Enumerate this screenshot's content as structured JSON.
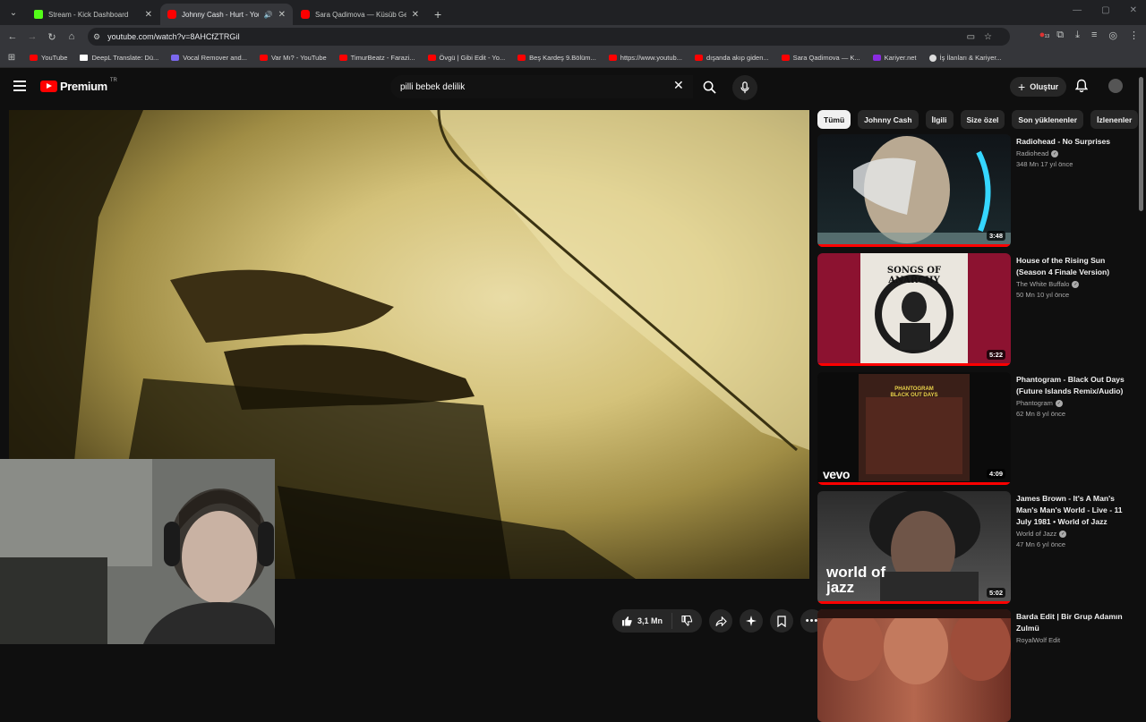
{
  "browser": {
    "tabs": [
      {
        "title": "Stream - Kick Dashboard",
        "color": "#53fc18"
      },
      {
        "title": "Johnny Cash - Hurt - YouTube",
        "color": "#ff0000"
      },
      {
        "title": "Sara Qadimova — Küsüb Getdi",
        "color": "#ff0000"
      }
    ],
    "url": "youtube.com/watch?v=8AHCfZTRGiI",
    "bookmarks": [
      {
        "label": "YouTube",
        "color": "#ff0000"
      },
      {
        "label": "DeepL Translate: Dü...",
        "color": "#ffffff"
      },
      {
        "label": "Vocal Remover and...",
        "color": "#7b68ee"
      },
      {
        "label": "Var Mı? - YouTube",
        "color": "#ff0000"
      },
      {
        "label": "TimurBeatz - Farazi...",
        "color": "#ff0000"
      },
      {
        "label": "Övgü | Gibi Edit - Yo...",
        "color": "#ff0000"
      },
      {
        "label": "Beş Kardeş 9.Bölüm...",
        "color": "#ff0000"
      },
      {
        "label": "https://www.youtub...",
        "color": "#ff0000"
      },
      {
        "label": "dışanda akıp giden...",
        "color": "#ff0000"
      },
      {
        "label": "Sara Qadimova — K...",
        "color": "#ff0000"
      },
      {
        "label": "Kariyer.net",
        "color": "#8a2be2"
      },
      {
        "label": "İş İlanları & Kariyer...",
        "color": "#dddddd"
      }
    ],
    "profile_badge": "13"
  },
  "header": {
    "logo": "Premium",
    "region": "TR",
    "search_query": "pilli bebek delilik",
    "create_label": "Oluştur"
  },
  "actions": {
    "likes": "3,1 Mn"
  },
  "chips": [
    "Tümü",
    "Johnny Cash",
    "İlgili",
    "Size özel",
    "Son yüklenenler",
    "İzlenenler"
  ],
  "recommendations": [
    {
      "title": "Radiohead - No Surprises",
      "channel": "Radiohead",
      "stats": "348 Mn  17 yıl önce",
      "duration": "3:48",
      "watched": 1.0
    },
    {
      "title": "House of the Rising Sun (Season 4 Finale Version)",
      "channel": "The White Buffalo",
      "stats": "50 Mn  10 yıl önce",
      "duration": "5:22",
      "watched": 1.0,
      "thumb_text": "SONGS OF ANARCHY"
    },
    {
      "title": "Phantogram - Black Out Days (Future Islands Remix/Audio)",
      "channel": "Phantogram",
      "stats": "62 Mn  8 yıl önce",
      "duration": "4:09",
      "watched": 1.0,
      "thumb_text": "PHANTOGRAM BLACK OUT DAYS",
      "thumb_brand": "vevo"
    },
    {
      "title": "James Brown - It's A Man's Man's Man's World - Live - 11 July 1981 • World of Jazz",
      "channel": "World of Jazz",
      "stats": "47 Mn  6 yıl önce",
      "duration": "5:02",
      "watched": 1.0,
      "thumb_text": "world of jazz"
    },
    {
      "title": "Barda Edit | Bir Grup Adamın Zulmü",
      "channel": "RoyalWolf Edit",
      "stats": "",
      "duration": "",
      "watched": 0
    }
  ]
}
